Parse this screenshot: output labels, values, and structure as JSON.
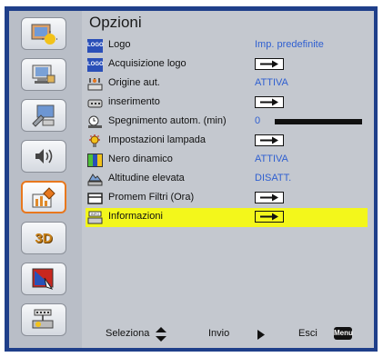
{
  "menu": {
    "title": "Opzioni"
  },
  "rows": [
    {
      "label": "Logo",
      "value": "Imp. predefinite",
      "icon": "logo-icon"
    },
    {
      "label": "Acquisizione logo",
      "icon": "logo-capture-icon"
    },
    {
      "label": "Origine aut.",
      "value": "ATTIVA",
      "icon": "auto-source-icon"
    },
    {
      "label": "inserimento",
      "icon": "input-icon"
    },
    {
      "label": "Spegnimento autom. (min)",
      "value": "0",
      "icon": "auto-off-icon",
      "slider_level": 0
    },
    {
      "label": "Impostazioni lampada",
      "icon": "lamp-settings-icon"
    },
    {
      "label": "Nero dinamico",
      "value": "ATTIVA",
      "icon": "dynamic-black-icon"
    },
    {
      "label": "Altitudine elevata",
      "value": "DISATT.",
      "icon": "high-altitude-icon"
    },
    {
      "label": "Promem Filtri (Ora)",
      "icon": "filter-reminder-icon"
    },
    {
      "label": "Informazioni",
      "icon": "information-icon"
    }
  ],
  "footer": {
    "select": "Seleziona",
    "enter": "Invio",
    "exit": "Esci",
    "menu_key": "Menu"
  },
  "sidebar": {
    "threed_label": "3D",
    "items": [
      "image-icon",
      "display-icon",
      "setup-icon",
      "audio-icon",
      "options-icon",
      "3d-icon",
      "network-icon",
      "lan-icon"
    ]
  },
  "colors": {
    "frame": "#1f3f8a",
    "panel": "#c4c8cf",
    "selection": "#f3f71b",
    "value_text": "#2f5fd0",
    "active_border": "#e8781e"
  }
}
